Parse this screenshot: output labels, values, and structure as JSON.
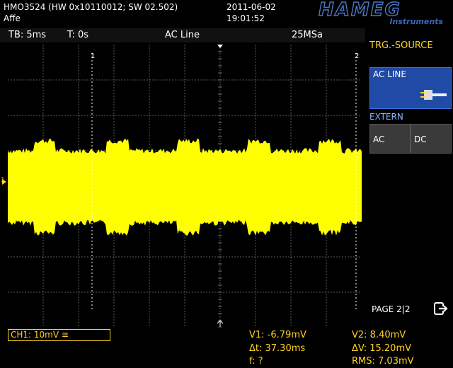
{
  "header": {
    "device": "HMO3524 (HW 0x10110012; SW 02.502)",
    "name": "Affe",
    "date": "2011-06-02",
    "time": "19:01:52",
    "brand": "HAMEG",
    "brand_sub": "Instruments",
    "brand_color": "#4a78c8"
  },
  "status_bar": {
    "timebase": "TB: 5ms",
    "trigger_time": "T: 0s",
    "trigger_source": "AC Line",
    "sample_rate": "25MSa"
  },
  "cursors": {
    "c1_label": "1",
    "c2_label": "2"
  },
  "channel_marker": "1",
  "side_menu": {
    "title": "TRG.-SOURCE",
    "ac_line_label": "AC LINE",
    "extern_label": "EXTERN",
    "ac_label": "AC",
    "dc_label": "DC",
    "page": "PAGE 2|2"
  },
  "channel": {
    "label": "CH1: 10mV ≅",
    "color": "#ffd21f"
  },
  "measurements": {
    "v1": "V1: -6.79mV",
    "v2": "V2: 8.40mV",
    "dt": "Δt: 37.30ms",
    "dv": "ΔV: 15.20mV",
    "f": "f: ?",
    "rms": "RMS: 7.03mV"
  },
  "colors": {
    "trace": "#ffff00",
    "accent": "#ffd21f",
    "selected_button": "#1f4aa6",
    "grid": "#5a5a5a"
  }
}
